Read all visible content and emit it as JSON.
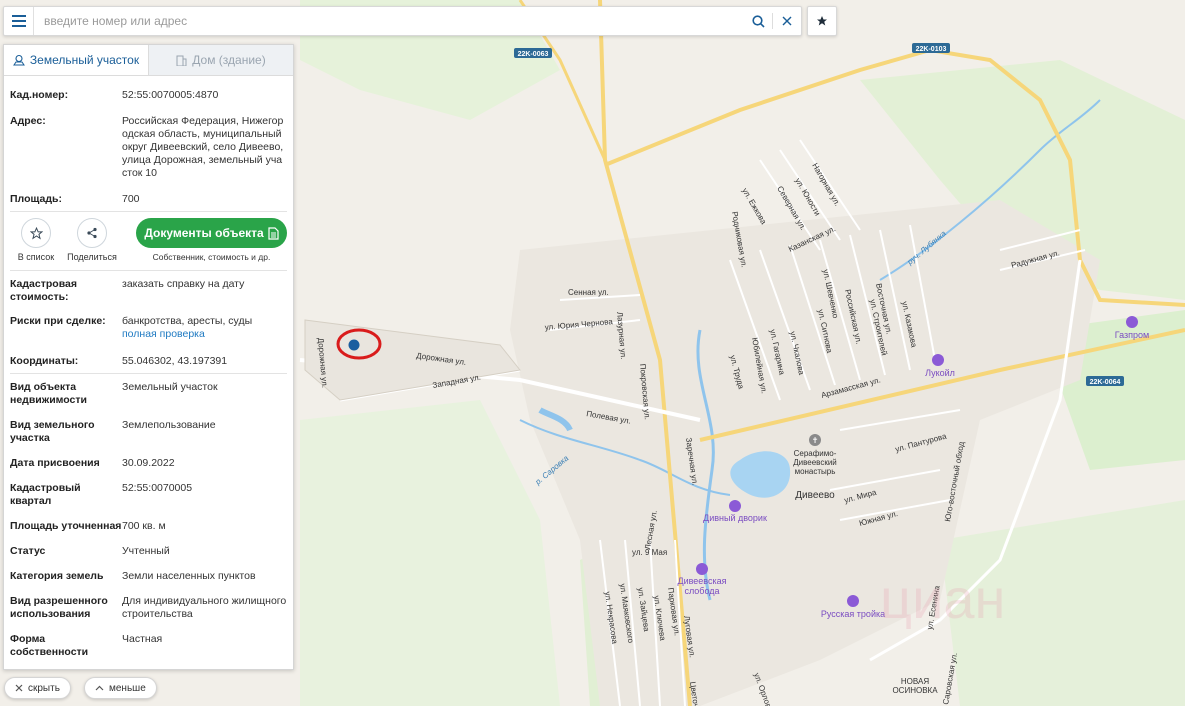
{
  "search": {
    "placeholder": "введите номер или адрес"
  },
  "icons": {
    "menu": "menu-icon",
    "search": "search-icon",
    "clear": "close-icon",
    "favorites": "star-icon"
  },
  "tabs": [
    {
      "label": "Земельный участок",
      "icon": "land-plot-icon",
      "active": true
    },
    {
      "label": "Дом (здание)",
      "icon": "building-icon",
      "active": false
    }
  ],
  "info_top": [
    {
      "label": "Кад.номер:",
      "value": "52:55:0070005:4870",
      "link": true
    },
    {
      "label": "Адрес:",
      "value": "Российская Федерация, Нижегородская область, муниципальный округ Дивеевский, село Дивеево, улица Дорожная, земельный участок 10",
      "link": false
    },
    {
      "label": "Площадь:",
      "value": "700",
      "link": false
    }
  ],
  "actions": {
    "add_to_list": "В список",
    "share": "Поделиться",
    "docs_button": "Документы объекта",
    "docs_sub": "Собственник, стоимость и др."
  },
  "cad_cost": {
    "label": "Кадастровая стоимость:",
    "value": "заказать справку на дату"
  },
  "risks": {
    "label": "Риски при сделке:",
    "value": "банкротства, аресты, суды",
    "link": "полная проверка"
  },
  "coords": {
    "label": "Координаты:",
    "value": "55.046302, 43.197391"
  },
  "details": [
    {
      "label": "Вид объекта недвижимости",
      "value": "Земельный участок"
    },
    {
      "label": "Вид земельного участка",
      "value": "Землепользование"
    },
    {
      "label": "Дата присвоения",
      "value": "30.09.2022"
    },
    {
      "label": "Кадастровый квартал",
      "value": "52:55:0070005"
    },
    {
      "label": "Площадь уточненная",
      "value": "700 кв. м"
    },
    {
      "label": "Статус",
      "value": "Учтенный"
    },
    {
      "label": "Категория земель",
      "value": "Земли населенных пунктов"
    },
    {
      "label": "Вид разрешенного использования",
      "value": "Для индивидуального жилищного строительства"
    },
    {
      "label": "Форма собственности",
      "value": "Частная"
    }
  ],
  "bottom": {
    "hide": "скрыть",
    "less": "меньше"
  },
  "map": {
    "roads": [
      "22K-0063",
      "22K-0103",
      "22K-0064"
    ],
    "town": "Дивеево",
    "monastery": "Серафимо-Дивеевский монастырь",
    "pois": [
      "Газпром",
      "Лукойл",
      "Дивный дворик",
      "Дивеевская слобода",
      "Русская тройка"
    ],
    "water": [
      "руч. Лубянка",
      "р. Саровка"
    ],
    "district": "НОВАЯ ОСИНОВКА",
    "bypass": "Юго-восточный обход",
    "streets": [
      "Дорожная ул.",
      "Западная ул.",
      "Дорожная ул.",
      "Сенная ул.",
      "ул. Юрия Чернова",
      "Лазурная ул.",
      "Покровская ул.",
      "Полевая ул.",
      "Заречная ул.",
      "Лесная ул.",
      "ул. 9 Мая",
      "ул. Некрасова",
      "ул. Маяковского",
      "ул. Зайцева",
      "ул. Ключева",
      "Парковая ул.",
      "Луговая ул.",
      "Арзамасская ул.",
      "ул. Пантурова",
      "ул. Мира",
      "Южная ул.",
      "Казанская ул.",
      "Радужная ул.",
      "Родниковая ул.",
      "ул. Ежкова",
      "Северная ул.",
      "ул. Юности",
      "Нагорная ул.",
      "Юбилейная ул.",
      "ул. Труда",
      "ул. Гагарина",
      "ул. Чкалова",
      "ул. Ситнова",
      "Российская ул.",
      "ул. Шевченко",
      "ул. Строителей",
      "Восточная ул.",
      "ул. Казакова",
      "ул. Есенина",
      "Саровская ул.",
      "Цветочная ул.",
      "ул. Орловская"
    ],
    "watermark": "циан"
  }
}
